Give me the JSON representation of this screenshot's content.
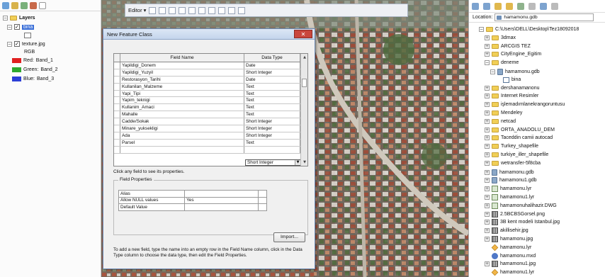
{
  "toc": {
    "layers_label": "Layers",
    "bina_label": "bina",
    "texture_label": "texture.jpg",
    "rgb_label": "RGB",
    "bands": [
      {
        "label": "Red:",
        "band": "Band_1",
        "color": "#e02020"
      },
      {
        "label": "Green:",
        "band": "Band_2",
        "color": "#2fa82f"
      },
      {
        "label": "Blue:",
        "band": "Band_3",
        "color": "#2c3fd6"
      }
    ]
  },
  "editor": {
    "label": "Editor ▾"
  },
  "dialog": {
    "title": "New Feature Class",
    "close_label": "✕",
    "header": {
      "name": "Field Name",
      "type": "Data Type"
    },
    "fields": [
      {
        "name": "Yapildigi_Donem",
        "type": "Date"
      },
      {
        "name": "Yapildigi_Yuzyil",
        "type": "Short Integer"
      },
      {
        "name": "Restorasyon_Tarihi",
        "type": "Date"
      },
      {
        "name": "Kullanilan_Malzeme",
        "type": "Text"
      },
      {
        "name": "Yapi_Tipi",
        "type": "Text"
      },
      {
        "name": "Yapim_teknigi",
        "type": "Text"
      },
      {
        "name": "Kullanim_Amaci",
        "type": "Text"
      },
      {
        "name": "Mahalle",
        "type": "Text"
      },
      {
        "name": "Cadde/Sokak",
        "type": "Short Integer"
      },
      {
        "name": "Minare_yuksekligi",
        "type": "Short Integer"
      },
      {
        "name": "Ada",
        "type": "Short Integer"
      },
      {
        "name": "Parsel",
        "type": "Text"
      },
      {
        "name": "",
        "type": ""
      }
    ],
    "selected_type": "Short Integer",
    "click_hint": "Click any field to see its properties.",
    "field_properties_label": "Field Properties",
    "properties": [
      {
        "name": "Alias",
        "value": ""
      },
      {
        "name": "Allow NULL values",
        "value": "Yes"
      },
      {
        "name": "Default Value",
        "value": ""
      }
    ],
    "import_label": "Import...",
    "help_text": "To add a new field, type the name into an empty row in the Field Name column, click in the Data Type column to choose the data type, then edit the Field Properties."
  },
  "catalog": {
    "location_label": "Location:",
    "location_value": "hamamonu.gdb",
    "items": [
      {
        "label": "C:\\Users\\DELL\\Desktop\\Tez18092018",
        "icon": "folder-icon",
        "level": 0,
        "exp": "−"
      },
      {
        "label": "3dmax",
        "icon": "folder-icon",
        "level": 1,
        "exp": "+"
      },
      {
        "label": "ARCGIS TEZ",
        "icon": "folder-icon",
        "level": 1,
        "exp": "+"
      },
      {
        "label": "CityEngine_Egitim",
        "icon": "folder-icon",
        "level": 1,
        "exp": "+"
      },
      {
        "label": "deneme",
        "icon": "folder-icon",
        "level": 1,
        "exp": "−"
      },
      {
        "label": "hamamonu.gdb",
        "icon": "geodatabase-icon",
        "level": 2,
        "exp": "−"
      },
      {
        "label": "bina",
        "icon": "feature-class-icon",
        "level": 3,
        "exp": ""
      },
      {
        "label": "dershanamanonu",
        "icon": "folder-icon",
        "level": 1,
        "exp": "+"
      },
      {
        "label": "Internet Resimler",
        "icon": "folder-icon",
        "level": 1,
        "exp": "+"
      },
      {
        "label": "işlemadırnlanekrangoruntusu",
        "icon": "folder-icon",
        "level": 1,
        "exp": "+"
      },
      {
        "label": "Mendeley",
        "icon": "folder-icon",
        "level": 1,
        "exp": "+"
      },
      {
        "label": "netcad",
        "icon": "folder-icon",
        "level": 1,
        "exp": "+"
      },
      {
        "label": "ORTA_ANADOLU_DEM",
        "icon": "folder-icon",
        "level": 1,
        "exp": "+"
      },
      {
        "label": "Taceddin camii autocad",
        "icon": "folder-icon",
        "level": 1,
        "exp": "+"
      },
      {
        "label": "Turkey_shapefile",
        "icon": "folder-icon",
        "level": 1,
        "exp": "+"
      },
      {
        "label": "turkiye_iller_shapefile",
        "icon": "folder-icon",
        "level": 1,
        "exp": "+"
      },
      {
        "label": "wetransfer-5f8cba",
        "icon": "folder-icon",
        "level": 1,
        "exp": "+"
      },
      {
        "label": "hamamonu.gdb",
        "icon": "geodatabase-icon",
        "level": 1,
        "exp": "+"
      },
      {
        "label": "hamamonu1.gdb",
        "icon": "geodatabase-icon",
        "level": 1,
        "exp": "+"
      },
      {
        "label": "hamamonu.lyr",
        "icon": "layer-file-icon",
        "level": 1,
        "exp": "+"
      },
      {
        "label": "hamamonu1.lyr",
        "icon": "layer-file-icon",
        "level": 1,
        "exp": "+"
      },
      {
        "label": "hamamonuhalihazir.DWG",
        "icon": "layer-file-icon",
        "level": 1,
        "exp": "+"
      },
      {
        "label": "2.5BCBSGorsel.png",
        "icon": "raster-icon",
        "level": 1,
        "exp": "+"
      },
      {
        "label": "3B kent modeli Istanbul.jpg",
        "icon": "raster-icon",
        "level": 1,
        "exp": "+"
      },
      {
        "label": "akillisehir.jpg",
        "icon": "raster-icon",
        "level": 1,
        "exp": "+"
      },
      {
        "label": "hamamonu.jpg",
        "icon": "raster-icon",
        "level": 1,
        "exp": "+"
      },
      {
        "label": "hamamonu.lyr",
        "icon": "map-document-icon",
        "level": 1,
        "exp": ""
      },
      {
        "label": "hamamonu.mxd",
        "icon": "globe-icon",
        "level": 1,
        "exp": ""
      },
      {
        "label": "hamamonu1.jpg",
        "icon": "raster-icon",
        "level": 1,
        "exp": "+"
      },
      {
        "label": "hamamonu1.lyr",
        "icon": "map-document-icon",
        "level": 1,
        "exp": ""
      }
    ]
  }
}
